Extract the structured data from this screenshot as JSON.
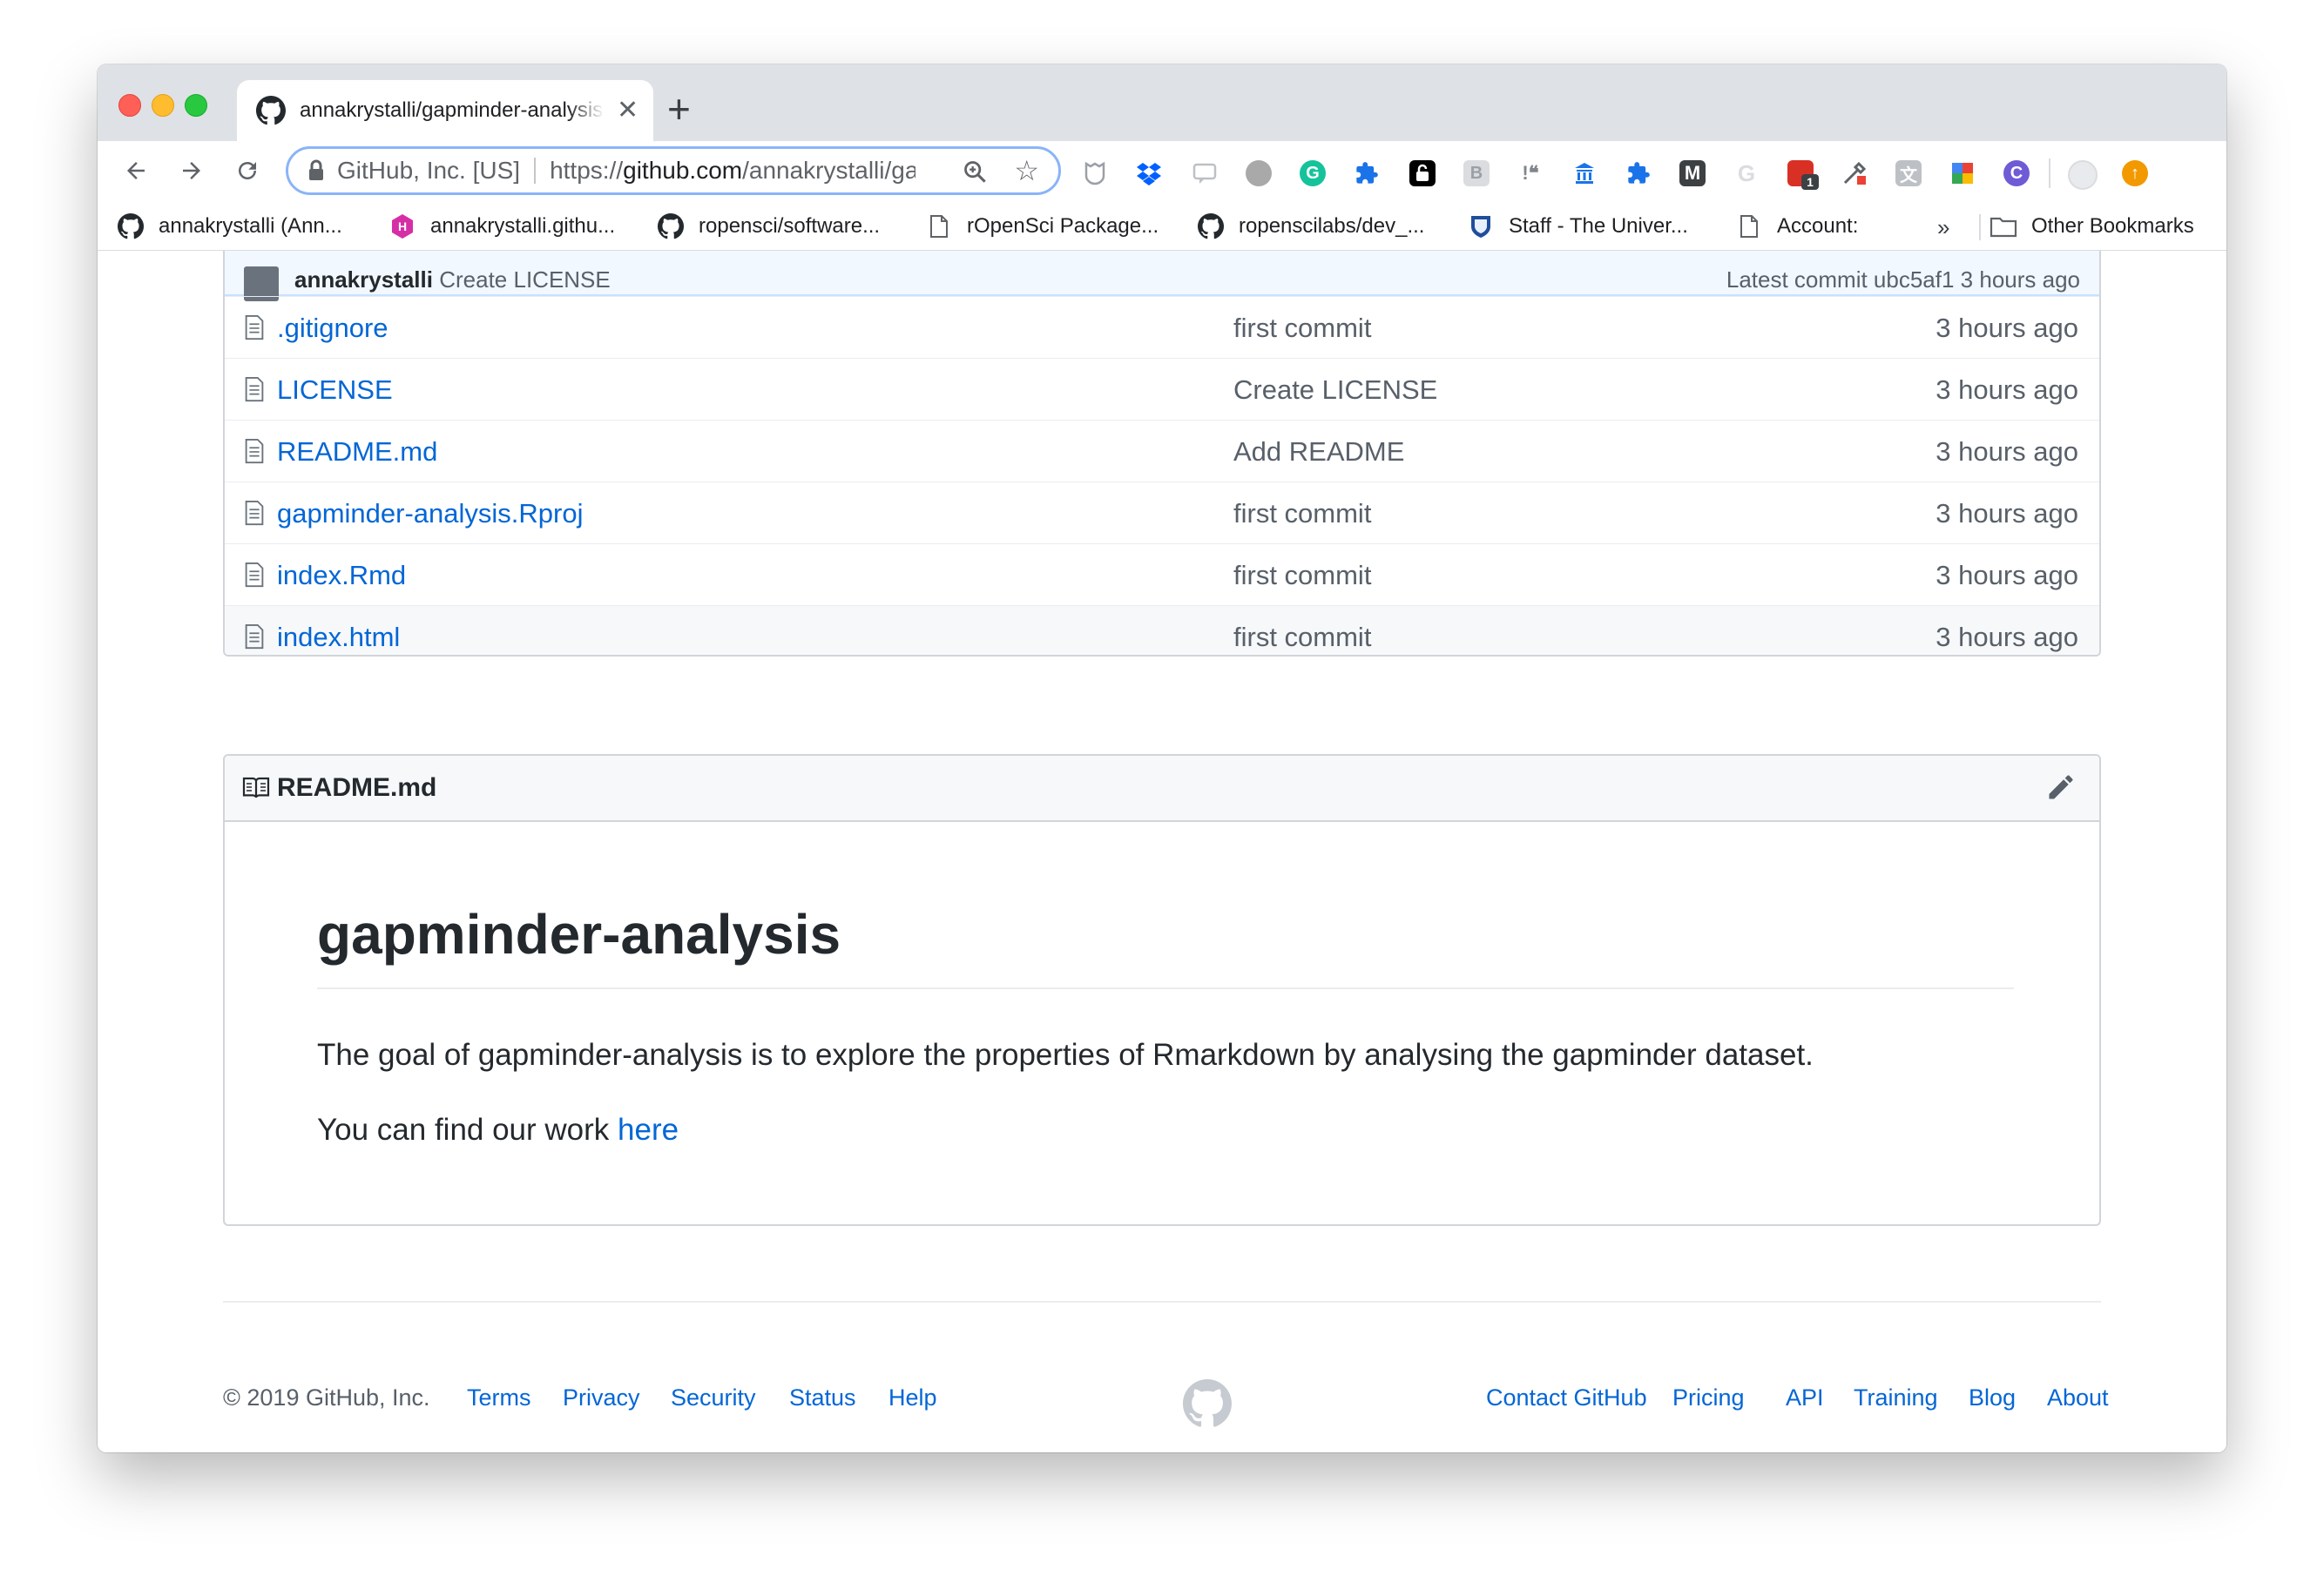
{
  "browser": {
    "tab_title": "annakrystalli/gapminder-analysis",
    "tab_close": "✕",
    "new_tab": "+",
    "site_identity": "GitHub, Inc. [US]",
    "url_prefix": "https://",
    "url_host": "github.com",
    "url_path": "/annakrystalli/gapminder-analysis",
    "extensions": [
      "ghostery-icon",
      "dropbox-icon",
      "chat-icon",
      "turtle-icon",
      "grammarly-icon",
      "puzzle-icon",
      "lock-icon",
      "b-icon",
      "quote-icon",
      "library-icon",
      "puzzle-icon-2",
      "m-icon",
      "google-icon",
      "calendar-icon",
      "pipette-icon",
      "translate-icon",
      "maps-icon",
      "circle-c-icon",
      "profile-icon",
      "update-icon"
    ],
    "extension_badge": "1"
  },
  "bookmarks": [
    {
      "label": "annakrystalli (Ann...",
      "icon": "github-icon"
    },
    {
      "label": "annakrystalli.githu...",
      "icon": "hex-h-icon"
    },
    {
      "label": "ropensci/software...",
      "icon": "github-icon"
    },
    {
      "label": "rOpenSci Package...",
      "icon": "page-icon"
    },
    {
      "label": "ropenscilabs/dev_...",
      "icon": "github-icon"
    },
    {
      "label": "Staff - The Univer...",
      "icon": "shield-icon"
    },
    {
      "label": "Account:",
      "icon": "page-icon"
    }
  ],
  "bookmarks_more": "»",
  "other_bookmarks": "Other Bookmarks",
  "repo": {
    "latest_author": "annakrystalli",
    "latest_message": "Create LICENSE",
    "latest_commit": "Latest commit ubc5af1 3 hours ago",
    "files": [
      {
        "name": ".gitignore",
        "message": "first commit",
        "age": "3 hours ago"
      },
      {
        "name": "LICENSE",
        "message": "Create LICENSE",
        "age": "3 hours ago"
      },
      {
        "name": "README.md",
        "message": "Add README",
        "age": "3 hours ago"
      },
      {
        "name": "gapminder-analysis.Rproj",
        "message": "first commit",
        "age": "3 hours ago"
      },
      {
        "name": "index.Rmd",
        "message": "first commit",
        "age": "3 hours ago"
      },
      {
        "name": "index.html",
        "message": "first commit",
        "age": "3 hours ago"
      }
    ]
  },
  "readme": {
    "filename": "README.md",
    "heading": "gapminder-analysis",
    "paragraph1": "The goal of gapminder-analysis is to explore the properties of Rmarkdown by analysing the gapminder dataset.",
    "paragraph2_text": "You can find our work ",
    "paragraph2_link": "here"
  },
  "footer": {
    "copyright": "© 2019 GitHub, Inc.",
    "left_links": [
      "Terms",
      "Privacy",
      "Security",
      "Status",
      "Help"
    ],
    "right_links": [
      "Contact GitHub",
      "Pricing",
      "API",
      "Training",
      "Blog",
      "About"
    ]
  },
  "colors": {
    "link": "#0366d6",
    "omnibox_focus": "#8ab4f8",
    "commit_bar": "#f1f8ff"
  }
}
